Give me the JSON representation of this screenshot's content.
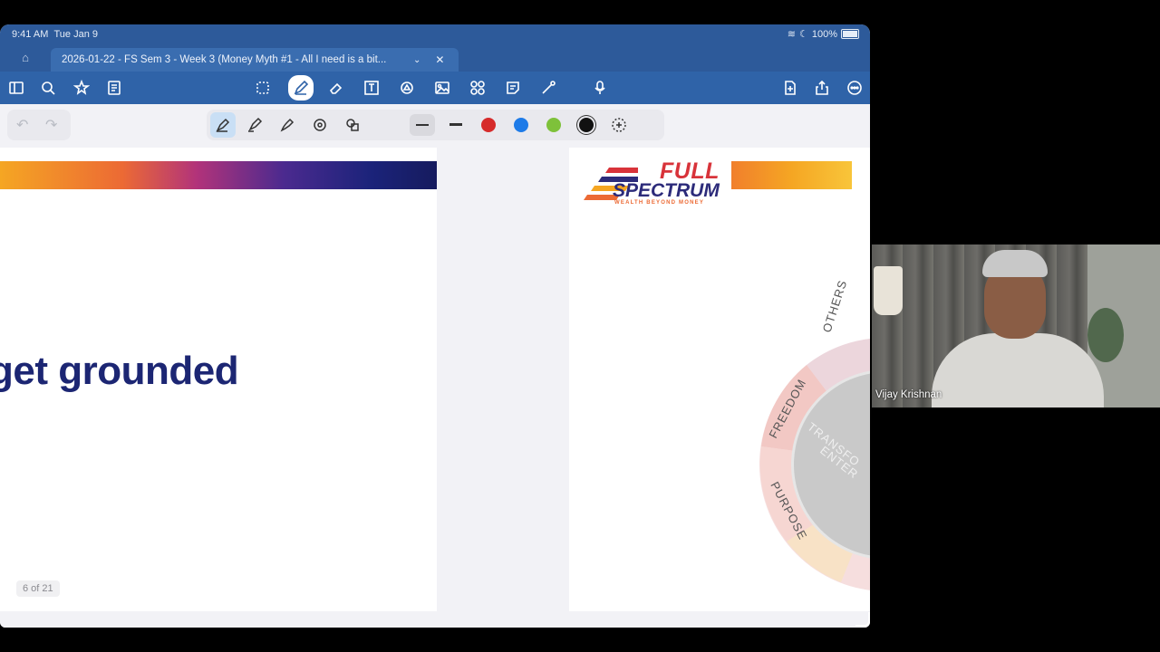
{
  "status_bar": {
    "time": "9:41 AM",
    "date": "Tue Jan 9",
    "battery": "100%"
  },
  "tabs": {
    "home_icon": "home-icon",
    "document_title": "2026-01-22 - FS Sem 3 - Week 3 (Money Myth #1 - All I need is a bit..."
  },
  "toolbar": {
    "left_icons": [
      "sidebar-icon",
      "search-icon",
      "bookmark-star-icon",
      "document-outline-icon"
    ],
    "center_icons": [
      "lasso-icon",
      "pen-icon",
      "eraser-icon",
      "text-box-icon",
      "shapes-icon",
      "image-icon",
      "elements-icon",
      "sticky-note-icon",
      "laser-pointer-icon",
      "microphone-icon"
    ],
    "right_icons": [
      "add-page-icon",
      "share-icon",
      "more-icon"
    ]
  },
  "pen_tray": {
    "tools": [
      "fountain-pen-icon",
      "highlighter-icon",
      "brush-pen-icon",
      "lasso-shape-icon",
      "shapes-pen-icon"
    ],
    "colors": [
      "#d62b2b",
      "#1e7be8",
      "#7ec13a",
      "#111111"
    ],
    "selected_color": "#111111"
  },
  "slide_left": {
    "heading": "get grounded",
    "page_count": "6 of 21"
  },
  "slide_right": {
    "logo_line1": "FULL",
    "logo_line2": "SPECTRUM",
    "logo_tagline": "WEALTH BEYOND MONEY",
    "wheel_labels": [
      "OTHERS",
      "FREEDOM",
      "PURPOSE"
    ],
    "wheel_center": [
      "TRANSFO",
      "ENTER"
    ]
  },
  "video": {
    "participant_name": "Vijay Krishnan"
  }
}
